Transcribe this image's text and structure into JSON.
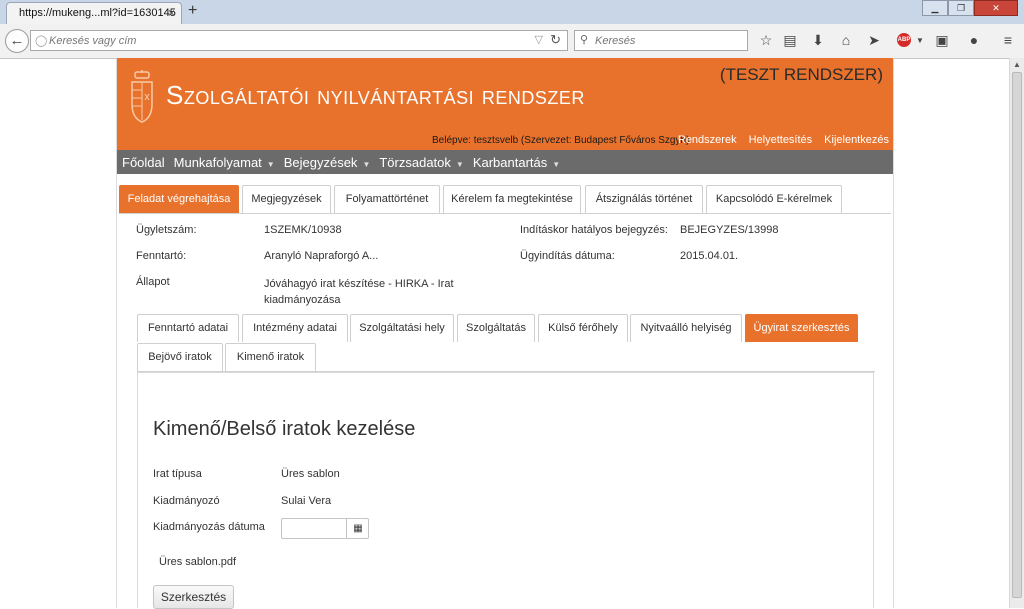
{
  "browser": {
    "tab_title": "https://mukeng...ml?id=1630145",
    "tab_close": "×",
    "new_tab": "+",
    "window_buttons": [
      "▁",
      "❐",
      "✕"
    ],
    "url_placeholder": "Keresés vagy cím",
    "search_placeholder": "Keresés"
  },
  "header": {
    "title": "Szolgáltatói nyilvántartási rendszer",
    "test_label": "(TESZT RENDSZER)",
    "logged_in": "Belépve: tesztsvelb (Szervezet: Budapest Főváros Szgyh)",
    "links": [
      "Rendszerek",
      "Helyettesítés",
      "Kijelentkezés"
    ]
  },
  "menu": {
    "items": [
      {
        "label": "Főoldal",
        "caret": ""
      },
      {
        "label": "Munkafolyamat",
        "caret": "▼"
      },
      {
        "label": "Bejegyzések",
        "caret": "▼"
      },
      {
        "label": "Törzsadatok",
        "caret": "▼"
      },
      {
        "label": "Karbantartás",
        "caret": "▼"
      }
    ]
  },
  "tabs": [
    "Feladat végrehajtása",
    "Megjegyzések",
    "Folyamattörténet",
    "Kérelem fa megtekintése",
    "Átszignálás történet",
    "Kapcsolódó E-kérelmek"
  ],
  "info": {
    "ugyletszam_label": "Ügyletszám:",
    "ugyletszam": "1SZEMK/10938",
    "fenntarto_label": "Fenntartó:",
    "fenntarto": "Aranyló Napraforgó A...",
    "allapot_label": "Állapot",
    "allapot": "Jóváhagyó irat készítése - HIRKA - Irat kiadmányozása",
    "inditaskor_label": "Indításkor hatályos bejegyzés:",
    "inditaskor": "BEJEGYZES/13998",
    "ugyinditas_label": "Ügyindítás dátuma:",
    "ugyinditas": "2015.04.01."
  },
  "subtabs": {
    "row1": [
      "Fenntartó adatai",
      "Intézmény adatai",
      "Szolgáltatási hely",
      "Szolgáltatás",
      "Külső férőhely",
      "Nyitvaálló helyiség",
      "Ügyirat szerkesztés"
    ],
    "row2": [
      "Bejövő iratok",
      "Kimenő iratok"
    ]
  },
  "section": {
    "title": "Kimenő/Belső iratok kezelése",
    "irat_tipusa_label": "Irat típusa",
    "irat_tipusa": "Üres sablon",
    "kiadmanyozo_label": "Kiadmányozó",
    "kiadmanyozo": "Sulai Vera",
    "kiadmanyozas_datuma_label": "Kiadmányozás dátuma",
    "file_name": "Üres sablon.pdf",
    "edit_button": "Szerkesztés"
  },
  "colors": {
    "brand_orange": "#e8722c",
    "menu_gray": "#6b6b6b"
  },
  "icons": {
    "calendar": "calendar-icon",
    "back": "back-arrow-icon",
    "reload": "reload-icon"
  }
}
